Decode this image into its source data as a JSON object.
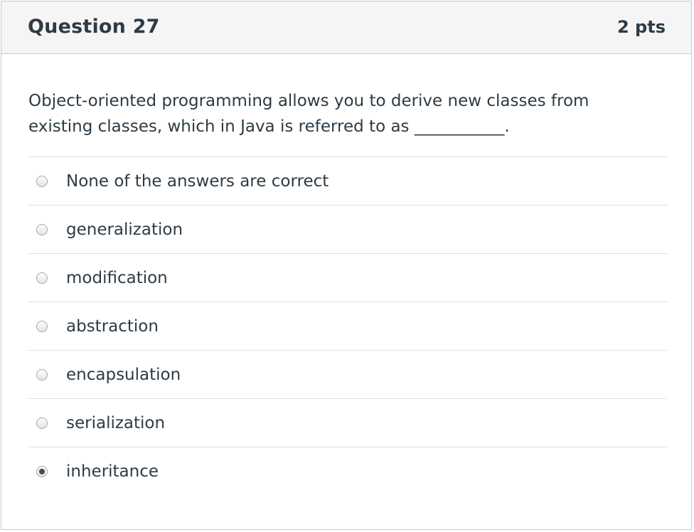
{
  "question": {
    "title": "Question 27",
    "points": "2 pts",
    "text": "Object-oriented programming allows you to derive new classes from existing classes, which in Java is referred to as ___________."
  },
  "answers": [
    {
      "label": "None of the answers are correct",
      "selected": false
    },
    {
      "label": "generalization",
      "selected": false
    },
    {
      "label": "modification",
      "selected": false
    },
    {
      "label": "abstraction",
      "selected": false
    },
    {
      "label": "encapsulation",
      "selected": false
    },
    {
      "label": "serialization",
      "selected": false
    },
    {
      "label": "inheritance",
      "selected": true
    }
  ]
}
